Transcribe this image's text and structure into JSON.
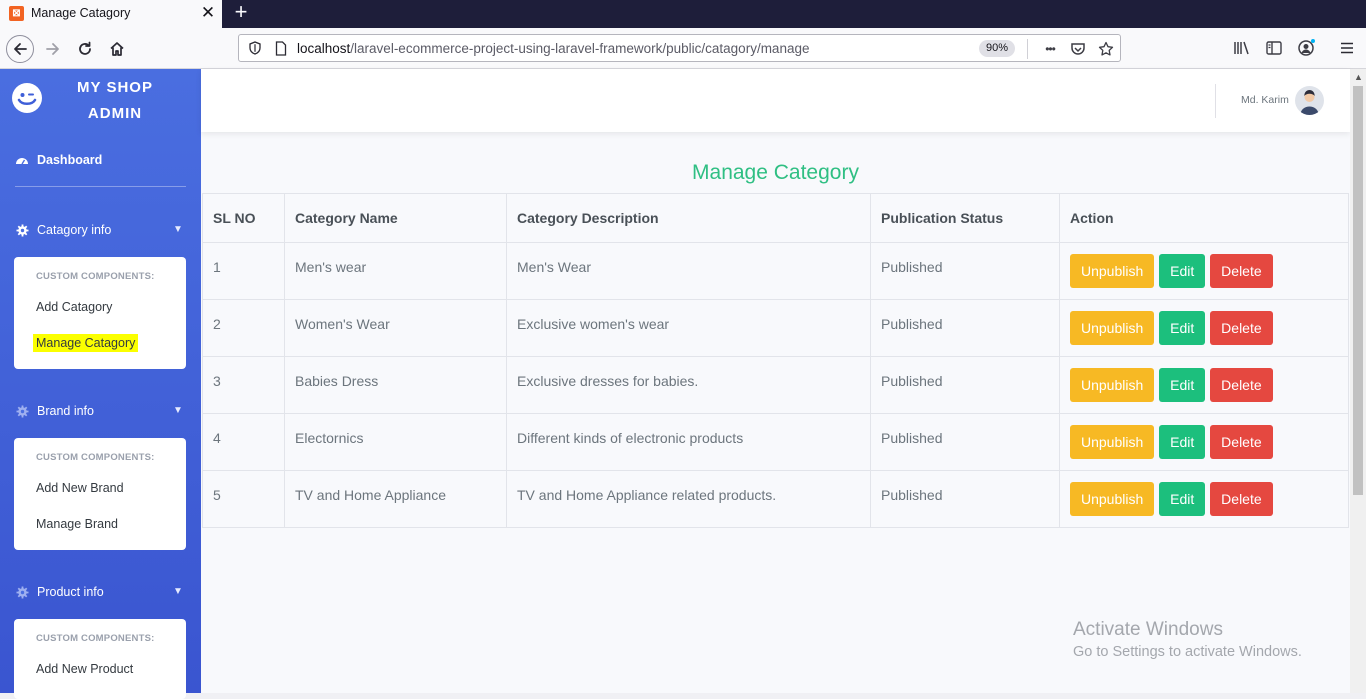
{
  "browser": {
    "tab_title": "Manage Catagory",
    "tab_favicon": "⊠",
    "tab_close": "✕",
    "new_tab": "+",
    "url_host": "localhost",
    "url_path": "/laravel-ecommerce-project-using-laravel-framework/public/catagory/manage",
    "zoom": "90%",
    "more_icon": "•••"
  },
  "sidebar": {
    "brand_line1": "MY SHOP",
    "brand_line2": "ADMIN",
    "dashboard": "Dashboard",
    "sections": [
      {
        "label": "Catagory info",
        "head": "CUSTOM COMPONENTS:",
        "links": [
          "Add Catagory",
          "Manage Catagory"
        ]
      },
      {
        "label": "Brand info",
        "head": "CUSTOM COMPONENTS:",
        "links": [
          "Add New Brand",
          "Manage Brand"
        ]
      },
      {
        "label": "Product info",
        "head": "CUSTOM COMPONENTS:",
        "links": [
          "Add New Product"
        ]
      }
    ],
    "active_link": "Manage Catagory"
  },
  "header": {
    "user_name": "Md. Karim"
  },
  "main": {
    "title": "Manage Category",
    "columns": [
      "SL NO",
      "Category Name",
      "Category Description",
      "Publication Status",
      "Action"
    ],
    "rows": [
      {
        "sl": "1",
        "name": "Men's wear",
        "desc": "Men's Wear",
        "status": "Published"
      },
      {
        "sl": "2",
        "name": "Women's Wear",
        "desc": "Exclusive women's wear",
        "status": "Published"
      },
      {
        "sl": "3",
        "name": "Babies Dress",
        "desc": "Exclusive dresses for babies.",
        "status": "Published"
      },
      {
        "sl": "4",
        "name": "Electornics",
        "desc": "Different kinds of electronic products",
        "status": "Published"
      },
      {
        "sl": "5",
        "name": "TV and Home Appliance",
        "desc": "TV and Home Appliance related products.",
        "status": "Published"
      }
    ],
    "actions": {
      "unpublish": "Unpublish",
      "edit": "Edit",
      "delete": "Delete"
    }
  },
  "watermark": {
    "line1": "Activate Windows",
    "line2": "Go to Settings to activate Windows."
  },
  "colors": {
    "sidebar": "#4a6ee0",
    "title": "#2fbf83",
    "warning": "#f7b924",
    "success": "#1cbf7d",
    "danger": "#e54840",
    "highlight": "#fbff00"
  }
}
